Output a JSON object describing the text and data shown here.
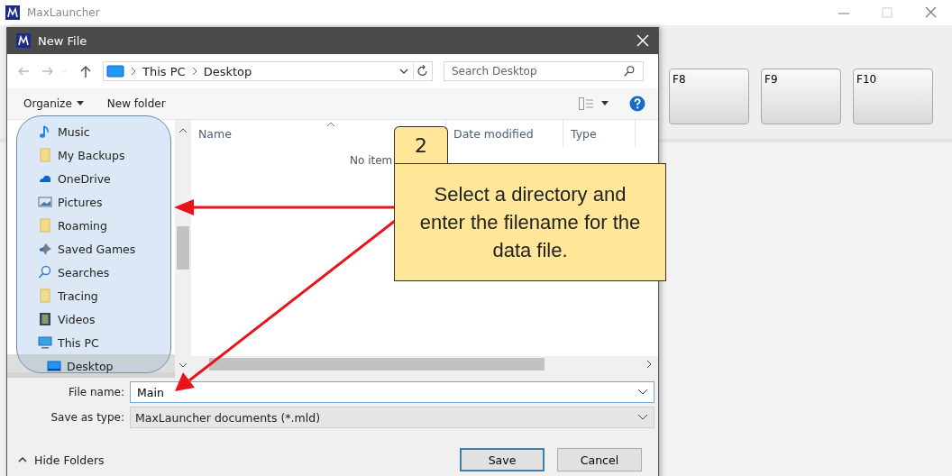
{
  "app": {
    "title": "MaxLauncher",
    "keys": [
      "F8",
      "F9",
      "F10"
    ]
  },
  "dialog": {
    "title": "New File",
    "breadcrumb": [
      "This PC",
      "Desktop"
    ],
    "search": {
      "placeholder": "Search Desktop"
    },
    "toolbar": [
      "Organize",
      "New folder"
    ],
    "nav": [
      {
        "label": "Music",
        "kind": "music",
        "selected": false
      },
      {
        "label": "My Backups",
        "kind": "folder",
        "selected": false
      },
      {
        "label": "OneDrive",
        "kind": "cloud",
        "selected": false
      },
      {
        "label": "Pictures",
        "kind": "pictures",
        "selected": false
      },
      {
        "label": "Roaming",
        "kind": "folder",
        "selected": false
      },
      {
        "label": "Saved Games",
        "kind": "games",
        "selected": false
      },
      {
        "label": "Searches",
        "kind": "search",
        "selected": false
      },
      {
        "label": "Tracing",
        "kind": "folder",
        "selected": false
      },
      {
        "label": "Videos",
        "kind": "videos",
        "selected": false
      },
      {
        "label": "This PC",
        "kind": "pc",
        "selected": false,
        "children": [
          {
            "label": "Desktop",
            "kind": "desktop",
            "selected": true
          }
        ]
      }
    ],
    "columns": [
      "Name",
      "Date modified",
      "Type"
    ],
    "empty_text": "No item",
    "file_name": {
      "label": "File name:",
      "value": "Main"
    },
    "save_type": {
      "label": "Save as type:",
      "value": "MaxLauncher documents (*.mld)"
    },
    "hide_folders": "Hide Folders",
    "buttons": [
      "Save",
      "Cancel"
    ]
  },
  "callout": {
    "step": "2",
    "text": "Select a directory and enter the filename for the data file."
  }
}
